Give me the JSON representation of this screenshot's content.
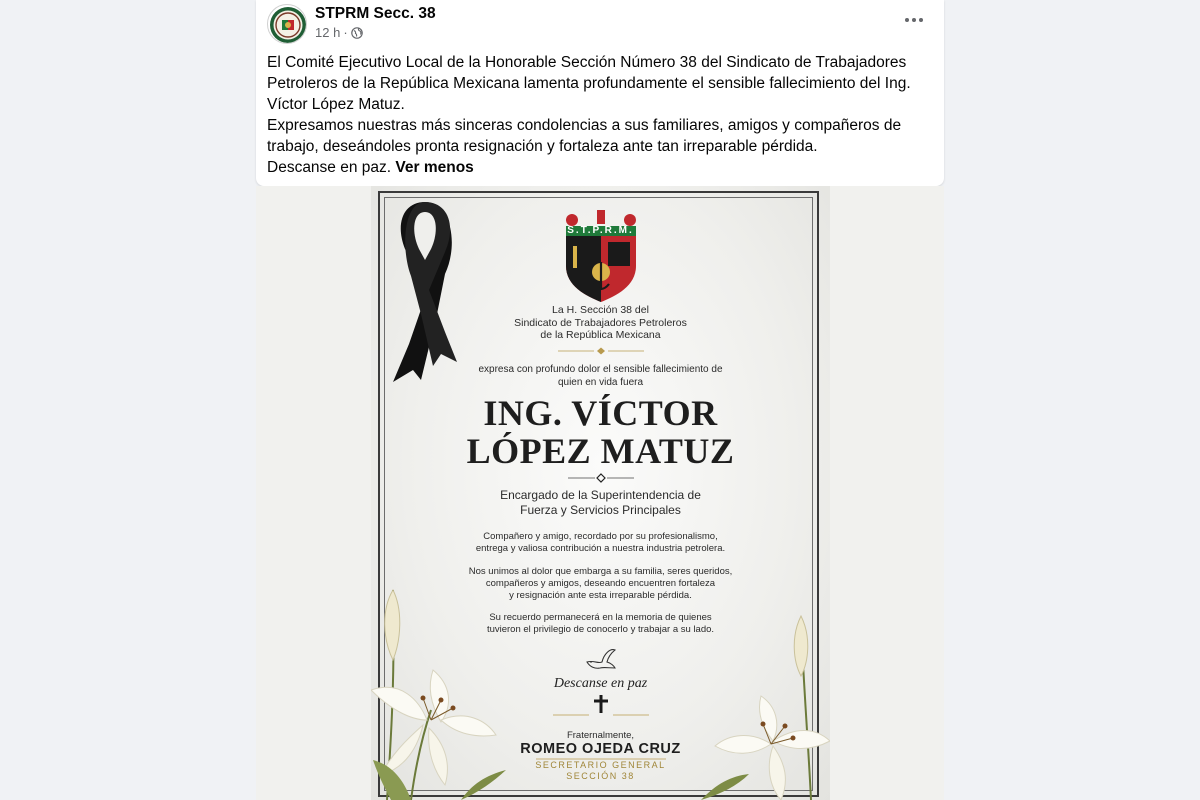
{
  "post": {
    "page_name": "STPRM Secc. 38",
    "time": "12 h",
    "separator": "·",
    "paragraphs": [
      "El Comité Ejecutivo Local de la Honorable Sección Número 38 del Sindicato de Trabajadores Petroleros de la República Mexicana lamenta profundamente el sensible fallecimiento del Ing. Víctor López Matuz.",
      "Expresamos nuestras más sinceras condolencias a sus familiares, amigos y compañeros de trabajo, deseándoles pronta resignación y fortaleza ante tan irreparable pérdida."
    ],
    "last_line": "Descanse en paz.",
    "see_less": "Ver menos"
  },
  "icons": {
    "avatar": "union-logo",
    "audience": "globe-icon",
    "more": "more-options-icon",
    "ribbon": "mourning-ribbon",
    "dove": "dove-icon",
    "cross": "cross-icon"
  },
  "card": {
    "emblem_text": "S.T.P.R.M.",
    "header_lines": [
      "La H. Sección 38 del",
      "Sindicato de Trabajadores Petroleros",
      "de la República Mexicana"
    ],
    "intro_lines": [
      "expresa con profundo dolor el sensible fallecimiento de",
      "quien en vida fuera"
    ],
    "name_lines": [
      "ING. VÍCTOR",
      "LÓPEZ MATUZ"
    ],
    "position_lines": [
      "Encargado de la Superintendencia de",
      "Fuerza y Servicios Principales"
    ],
    "para1": [
      "Compañero y amigo, recordado por su profesionalismo,",
      "entrega y valiosa contribución a nuestra industria petrolera."
    ],
    "para2": [
      "Nos unimos al dolor que embarga a su familia, seres queridos,",
      "compañeros y amigos, deseando encuentren fortaleza",
      "y resignación ante esta irreparable pérdida."
    ],
    "para3": [
      "Su recuerdo permanecerá en la memoria de quienes",
      "tuvieron el privilegio de conocerlo y trabajar a su lado."
    ],
    "rip": "Descanse en paz",
    "closing": "Fraternalmente,",
    "signer": "ROMEO OJEDA CRUZ",
    "signer_title": "SECRETARIO GENERAL",
    "signer_section": "SECCIÓN 38"
  },
  "colors": {
    "fb_text": "#050505",
    "fb_secondary": "#65676b",
    "fb_background": "#f0f2f5",
    "emblem_red": "#c0282d",
    "emblem_green": "#1f7a3a",
    "emblem_black": "#1a1a1a",
    "gold": "#b89a4e"
  }
}
